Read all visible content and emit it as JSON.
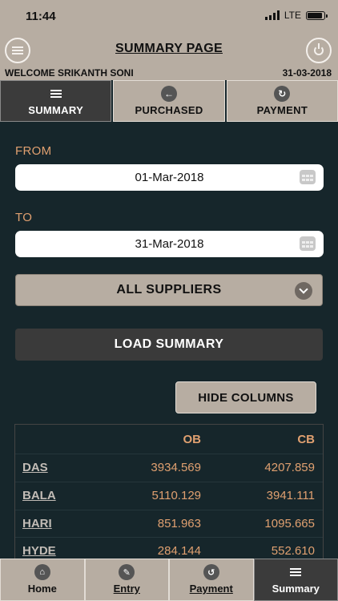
{
  "status_bar": {
    "time": "11:44",
    "network": "LTE"
  },
  "header": {
    "title": "SUMMARY PAGE",
    "welcome": "WELCOME SRIKANTH SONI",
    "date": "31-03-2018"
  },
  "tabs": [
    {
      "label": "SUMMARY",
      "icon": "menu-icon",
      "active": true
    },
    {
      "label": "PURCHASED",
      "icon": "arrow-left-icon",
      "active": false
    },
    {
      "label": "PAYMENT",
      "icon": "redo-icon",
      "active": false
    }
  ],
  "form": {
    "from_label": "FROM",
    "from_value": "01-Mar-2018",
    "to_label": "TO",
    "to_value": "31-Mar-2018",
    "supplier": "ALL SUPPLIERS",
    "load_label": "LOAD SUMMARY",
    "hide_columns_label": "HIDE COLUMNS"
  },
  "table": {
    "headers": {
      "name": "",
      "ob": "OB",
      "cb": "CB"
    },
    "rows": [
      {
        "name": "DAS",
        "ob": "3934.569",
        "cb": "4207.859"
      },
      {
        "name": "BALA",
        "ob": "5110.129",
        "cb": "3941.111"
      },
      {
        "name": "HARI",
        "ob": "851.963",
        "cb": "1095.665"
      },
      {
        "name": "HYDE",
        "ob": "284.144",
        "cb": "552.610"
      }
    ]
  },
  "bottom_nav": [
    {
      "label": "Home",
      "icon": "home-icon",
      "active": false
    },
    {
      "label": "Entry",
      "icon": "pencil-icon",
      "active": false
    },
    {
      "label": "Payment",
      "icon": "undo-icon",
      "active": false
    },
    {
      "label": "Summary",
      "icon": "menu-icon",
      "active": true
    }
  ],
  "colors": {
    "panel": "#b7ada2",
    "background": "#16262b",
    "accent": "#e0a070",
    "dark_button": "#3a3a3a"
  }
}
